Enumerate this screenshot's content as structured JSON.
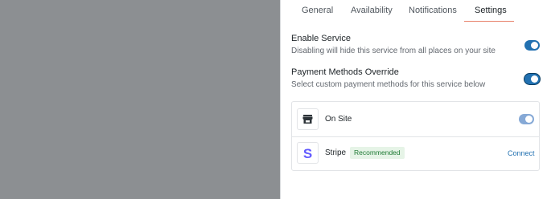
{
  "tabs": [
    {
      "label": "General"
    },
    {
      "label": "Availability"
    },
    {
      "label": "Notifications"
    },
    {
      "label": "Settings"
    }
  ],
  "active_tab": "Settings",
  "enable_service": {
    "title": "Enable Service",
    "description": "Disabling will hide this service from all places on your site",
    "enabled": true
  },
  "payment_override": {
    "title": "Payment Methods Override",
    "description": "Select custom payment methods for this service below",
    "enabled": true
  },
  "payment_methods": [
    {
      "name": "On Site",
      "icon": "store-icon",
      "enabled": true
    },
    {
      "name": "Stripe",
      "icon": "stripe-logo",
      "badge": "Recommended",
      "action": "Connect"
    }
  ],
  "colors": {
    "accent": "#2271b1",
    "active_tab_underline": "#e8826b",
    "overlay": "#8c8f92",
    "stripe": "#635bff"
  }
}
